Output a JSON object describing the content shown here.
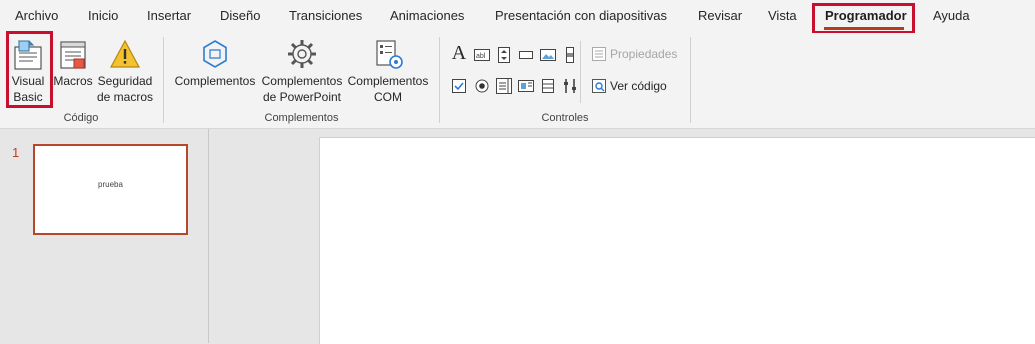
{
  "tabs": [
    {
      "label": "Archivo"
    },
    {
      "label": "Inicio"
    },
    {
      "label": "Insertar"
    },
    {
      "label": "Diseño"
    },
    {
      "label": "Transiciones"
    },
    {
      "label": "Animaciones"
    },
    {
      "label": "Presentación con diapositivas"
    },
    {
      "label": "Revisar"
    },
    {
      "label": "Vista"
    },
    {
      "label": "Programador"
    },
    {
      "label": "Ayuda"
    }
  ],
  "ribbon": {
    "codigo": {
      "label": "Código",
      "visual_basic": "Visual\nBasic",
      "macros": "Macros",
      "seguridad": "Seguridad\nde macros"
    },
    "complementos": {
      "label": "Complementos",
      "complementos": "Complementos",
      "ppt": "Complementos\nde PowerPoint",
      "com": "Complementos\nCOM"
    },
    "controles": {
      "label": "Controles",
      "propiedades": "Propiedades",
      "ver_codigo": "Ver código"
    }
  },
  "slides": [
    {
      "number": "1",
      "text": "prueba"
    }
  ],
  "colors": {
    "accent": "#b83b1e",
    "highlight": "#c8102e"
  }
}
